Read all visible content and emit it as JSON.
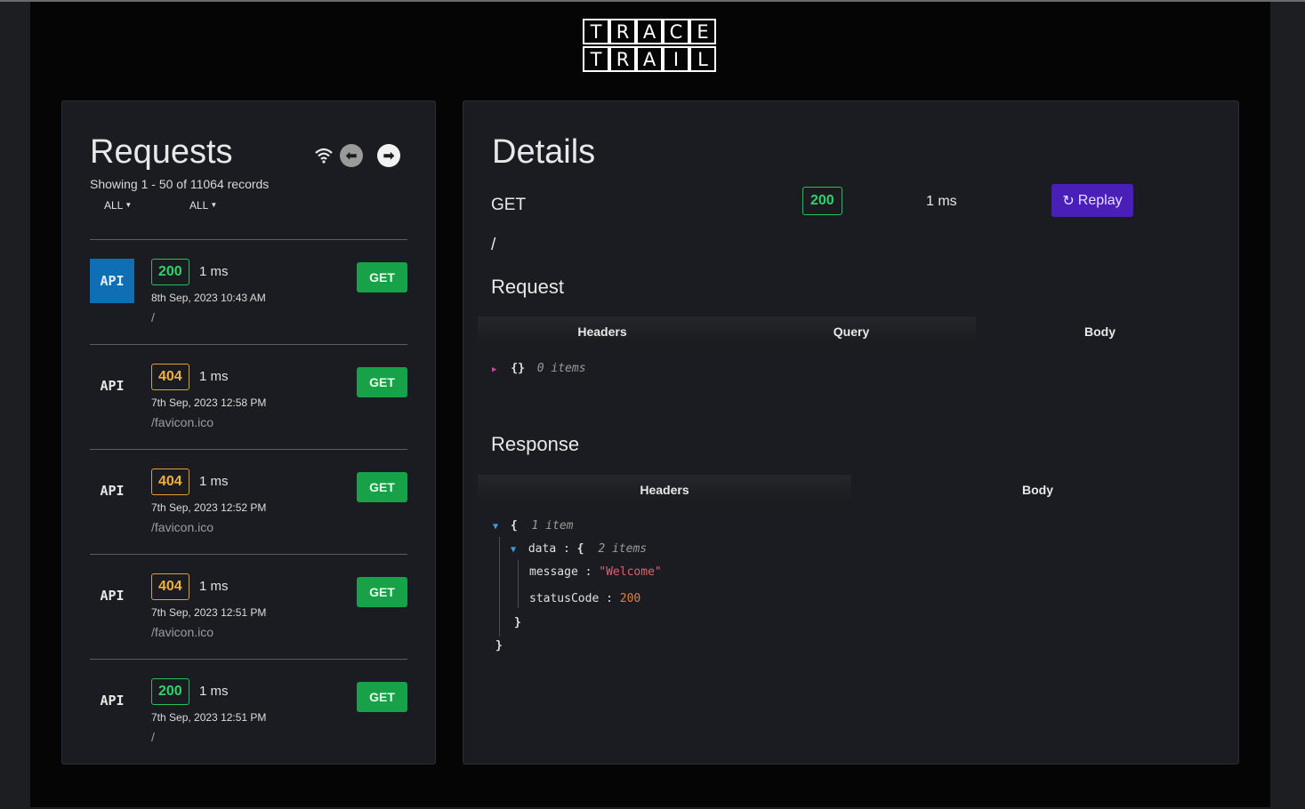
{
  "logo": {
    "row1": [
      "T",
      "R",
      "A",
      "C",
      "E"
    ],
    "row2": [
      "T",
      "R",
      "A",
      "I",
      "L"
    ]
  },
  "requests": {
    "title": "Requests",
    "showing": "Showing 1 - 50 of 11064 records",
    "filter_status": "ALL",
    "filter_method": "ALL",
    "items": [
      {
        "api": "API",
        "status": "200",
        "duration": "1 ms",
        "date": "8th Sep, 2023 10:43 AM",
        "path": "/",
        "method": "GET"
      },
      {
        "api": "API",
        "status": "404",
        "duration": "1 ms",
        "date": "7th Sep, 2023 12:58 PM",
        "path": "/favicon.ico",
        "method": "GET"
      },
      {
        "api": "API",
        "status": "404",
        "duration": "1 ms",
        "date": "7th Sep, 2023 12:52 PM",
        "path": "/favicon.ico",
        "method": "GET"
      },
      {
        "api": "API",
        "status": "404",
        "duration": "1 ms",
        "date": "7th Sep, 2023 12:51 PM",
        "path": "/favicon.ico",
        "method": "GET"
      },
      {
        "api": "API",
        "status": "200",
        "duration": "1 ms",
        "date": "7th Sep, 2023 12:51 PM",
        "path": "/",
        "method": "GET"
      }
    ]
  },
  "details": {
    "title": "Details",
    "method": "GET",
    "status": "200",
    "duration": "1 ms",
    "replay_label": "Replay",
    "path": "/",
    "request_title": "Request",
    "request_tabs": [
      "Headers",
      "Query",
      "Body"
    ],
    "request_json": {
      "brace": "{}",
      "meta": "0 items"
    },
    "response_title": "Response",
    "response_tabs": [
      "Headers",
      "Body"
    ],
    "response_json": {
      "open": "{",
      "meta": "1 item",
      "data_key": "data",
      "data_open": "{",
      "data_meta": "2 items",
      "message_key": "message",
      "message_val": "\"Welcome\"",
      "status_key": "statusCode",
      "status_val": "200",
      "colon": ":",
      "inner_close": "}",
      "outer_close": "}"
    }
  }
}
